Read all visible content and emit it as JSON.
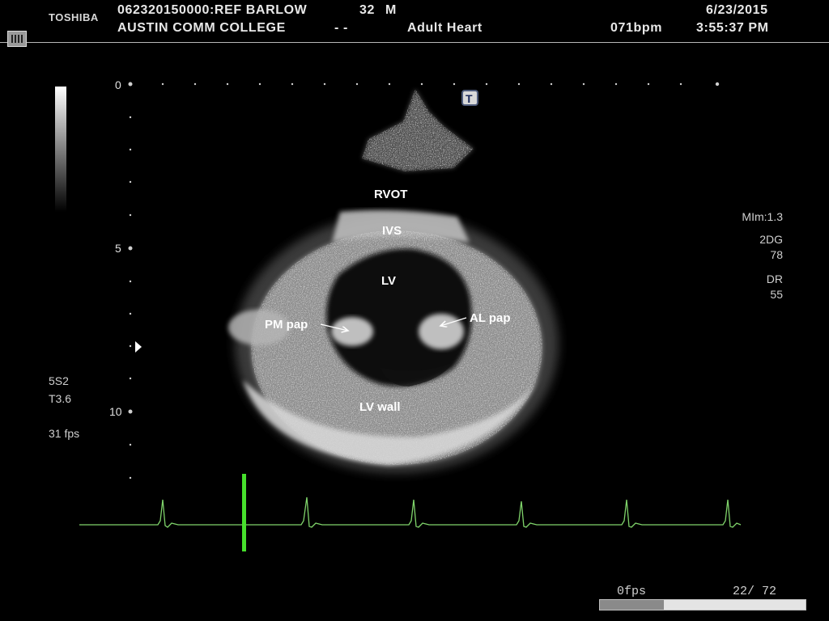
{
  "header": {
    "brand": "TOSHIBA",
    "patient_line": "062320150000:REF BARLOW",
    "age": "32",
    "sex": "M",
    "institution": "AUSTIN COMM COLLEGE",
    "dashes": "- -",
    "exam_type": "Adult Heart",
    "date": "6/23/2015",
    "heart_rate": "071bpm",
    "time": "3:55:37 PM"
  },
  "left_panel": {
    "probe": "5S2",
    "thermal": "T3.6",
    "frame_rate": "31 fps"
  },
  "right_panel": {
    "mi": "MIm:1.3",
    "mode": "2DG",
    "gain": "78",
    "dr_label": "DR",
    "dr_value": "55"
  },
  "depth_scale": {
    "labels": [
      "0",
      "5",
      "10"
    ]
  },
  "top_marker": "T",
  "annotations": {
    "rvot": "RVOT",
    "ivs": "IVS",
    "lv": "LV",
    "pm_pap": "PM pap",
    "al_pap": "AL pap",
    "lv_wall": "LV wall"
  },
  "footer": {
    "playback_fps": "0fps",
    "frame_counter": "22/ 72",
    "frame_progress": 0.31
  },
  "colors": {
    "ecg": "#7fd36a",
    "ecg_marker": "#46e02c",
    "tissue": "#c8c8c8"
  }
}
